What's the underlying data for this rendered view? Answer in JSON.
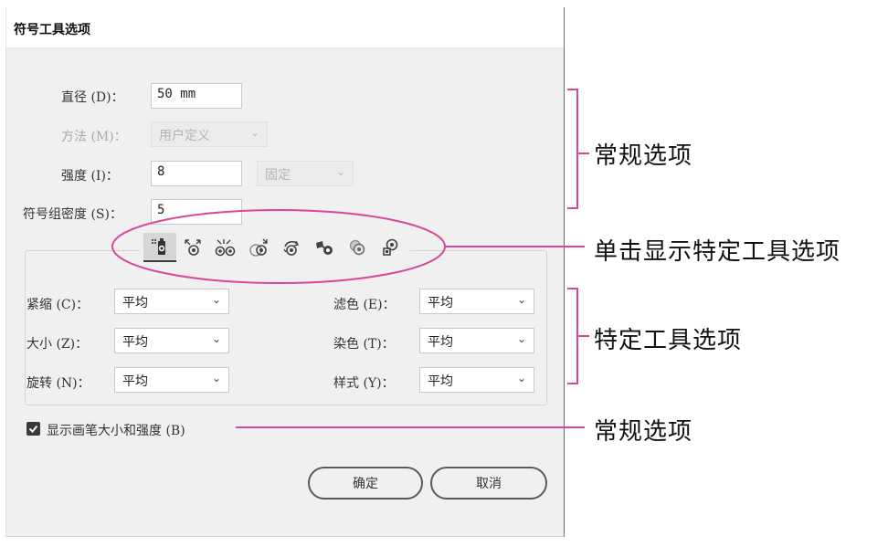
{
  "dialog": {
    "title": "符号工具选项"
  },
  "general": {
    "diameter": {
      "label": "直径 (D)：",
      "value": "50 mm"
    },
    "method": {
      "label": "方法 (M)：",
      "value": "用户定义"
    },
    "intensity": {
      "label": "强度 (I)：",
      "value": "8",
      "mode": "固定"
    },
    "density": {
      "label": "符号组密度 (S)：",
      "value": "5"
    }
  },
  "tools": [
    {
      "icon": "symbol-sprayer-icon"
    },
    {
      "icon": "symbol-shifter-icon"
    },
    {
      "icon": "symbol-scruncher-icon"
    },
    {
      "icon": "symbol-sizer-icon"
    },
    {
      "icon": "symbol-spinner-icon"
    },
    {
      "icon": "symbol-stainer-icon"
    },
    {
      "icon": "symbol-screener-icon"
    },
    {
      "icon": "symbol-styler-icon"
    }
  ],
  "tool_options": {
    "scrunch": {
      "label": "紧缩 (C)：",
      "value": "平均"
    },
    "size": {
      "label": "大小 (Z)：",
      "value": "平均"
    },
    "spin": {
      "label": "旋转 (N)：",
      "value": "平均"
    },
    "screen": {
      "label": "滤色 (E)：",
      "value": "平均"
    },
    "stain": {
      "label": "染色 (T)：",
      "value": "平均"
    },
    "style": {
      "label": "样式 (Y)：",
      "value": "平均"
    }
  },
  "show_brush": {
    "label": "显示画笔大小和强度 (B)",
    "checked": true
  },
  "buttons": {
    "ok": "确定",
    "cancel": "取消"
  },
  "annotations": {
    "general_top": "常规选项",
    "click_tool": "单击显示特定工具选项",
    "tool_specific": "特定工具选项",
    "general_bottom": "常规选项"
  },
  "colors": {
    "highlight": "#d9479b",
    "annotation_line": "#d9479b",
    "bracket": "#d9479b"
  }
}
